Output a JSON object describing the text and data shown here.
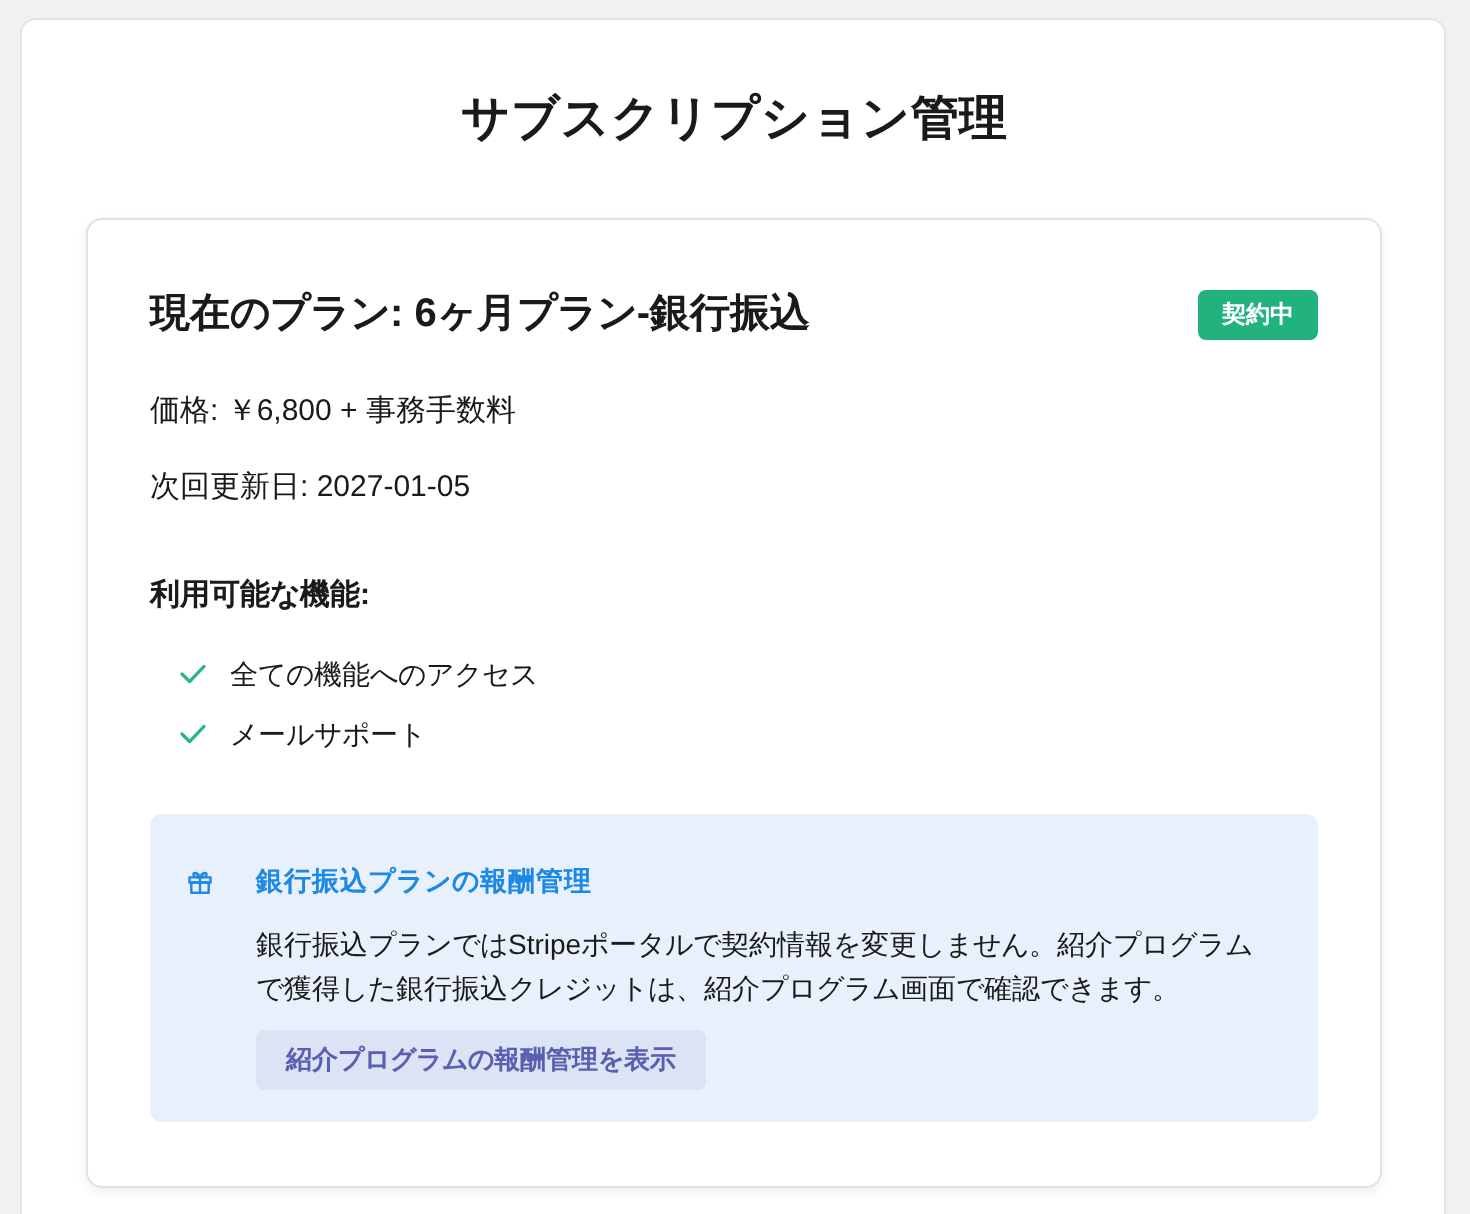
{
  "page": {
    "title": "サブスクリプション管理"
  },
  "plan": {
    "title": "現在のプラン: 6ヶ月プラン-銀行振込",
    "status_badge": "契約中",
    "price": "価格: ￥6,800 + 事務手数料",
    "next_renewal": "次回更新日: 2027-01-05"
  },
  "features": {
    "heading": "利用可能な機能:",
    "items": [
      "全ての機能へのアクセス",
      "メールサポート"
    ]
  },
  "notice": {
    "title": "銀行振込プランの報酬管理",
    "text": "銀行振込プランではStripeポータルで契約情報を変更しません。紹介プログラムで獲得した銀行振込クレジットは、紹介プログラム画面で確認できます。",
    "button": "紹介プログラムの報酬管理を表示"
  }
}
